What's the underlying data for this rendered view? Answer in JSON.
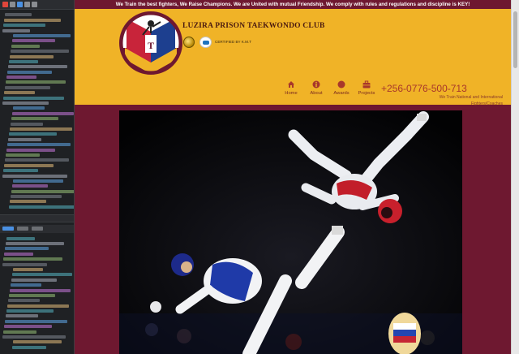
{
  "topbar": {
    "message": "We Train the best fighters, We Raise Champions. We are United with mutual Friendship. We comply with rules and regulations and discipline is KEY!"
  },
  "brand": {
    "club_name": "LUZIRA PRISON TAEKWONDO CLUB",
    "certified": "CERTIFIED BY K.M.T",
    "logo_icon": "club-crest",
    "header_color": "#f0b327",
    "maroon": "#6e1830",
    "accent": "#a8372b"
  },
  "nav": {
    "items": [
      {
        "label": "Home",
        "icon": "home-icon"
      },
      {
        "label": "About",
        "icon": "info-icon"
      },
      {
        "label": "Awards",
        "icon": "award-icon"
      },
      {
        "label": "Projects",
        "icon": "briefcase-icon"
      }
    ]
  },
  "contact": {
    "phone": "+256-0776-500-713",
    "tagline": "We Train National and International Fighters/Coaches"
  },
  "hero": {
    "image": "taekwondo-fighters-photo"
  }
}
